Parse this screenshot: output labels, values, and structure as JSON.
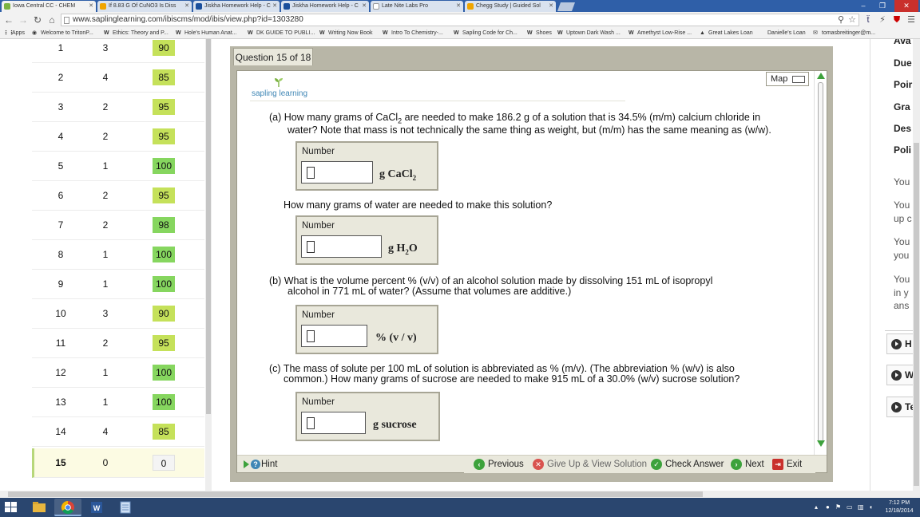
{
  "browser": {
    "tabs": [
      {
        "label": "Iowa Central CC - CHEM",
        "favicon_color": "#7cb342",
        "active": true
      },
      {
        "label": "If 8.83 G Of CuNO3 Is Diss",
        "favicon_color": "#f0a500",
        "active": false
      },
      {
        "label": "Jiskha Homework Help - C",
        "favicon_color": "#1a4f9c",
        "active": false
      },
      {
        "label": "Jiskha Homework Help - C",
        "favicon_color": "#1a4f9c",
        "active": false
      },
      {
        "label": "Late Nite Labs Pro",
        "favicon_color": "#cccccc",
        "active": false
      },
      {
        "label": "Chegg Study | Guided Sol",
        "favicon_color": "#f0a500",
        "active": false
      }
    ],
    "url": "www.saplinglearning.com/ibiscms/mod/ibis/view.php?id=1303280",
    "bookmarks": [
      {
        "label": "Apps",
        "icon": "apps-grid-icon"
      },
      {
        "label": "Welcome to TritonP...",
        "icon": "eye-icon"
      },
      {
        "label": "Ethics: Theory and P...",
        "icon": "wiley-icon"
      },
      {
        "label": "Hole's Human Anat...",
        "icon": "wiley-icon"
      },
      {
        "label": "DK GUIDE TO PUBLI...",
        "icon": "wiley-icon"
      },
      {
        "label": "Writing Now Book",
        "icon": "wiley-icon"
      },
      {
        "label": "Intro To Chemistry-...",
        "icon": "wiley-icon"
      },
      {
        "label": "Sapling Code for Ch...",
        "icon": "wiley-icon"
      },
      {
        "label": "Shoes",
        "icon": "wiley-icon"
      },
      {
        "label": "Uptown Dark Wash ...",
        "icon": "wiley-icon"
      },
      {
        "label": "Amethyst Low-Rise ...",
        "icon": "wiley-icon"
      },
      {
        "label": "Great Lakes Loan",
        "icon": "triangle-icon"
      },
      {
        "label": "Danielle's Loan",
        "icon": ""
      },
      {
        "label": "tomasbreitinger@m...",
        "icon": "mail-icon"
      }
    ]
  },
  "score_table": {
    "rows": [
      {
        "num": "1",
        "attempts": "3",
        "score": "90",
        "color": "lime"
      },
      {
        "num": "2",
        "attempts": "4",
        "score": "85",
        "color": "lime"
      },
      {
        "num": "3",
        "attempts": "2",
        "score": "95",
        "color": "lime"
      },
      {
        "num": "4",
        "attempts": "2",
        "score": "95",
        "color": "lime"
      },
      {
        "num": "5",
        "attempts": "1",
        "score": "100",
        "color": "green"
      },
      {
        "num": "6",
        "attempts": "2",
        "score": "95",
        "color": "lime"
      },
      {
        "num": "7",
        "attempts": "2",
        "score": "98",
        "color": "green"
      },
      {
        "num": "8",
        "attempts": "1",
        "score": "100",
        "color": "green"
      },
      {
        "num": "9",
        "attempts": "1",
        "score": "100",
        "color": "green"
      },
      {
        "num": "10",
        "attempts": "3",
        "score": "90",
        "color": "lime"
      },
      {
        "num": "11",
        "attempts": "2",
        "score": "95",
        "color": "lime"
      },
      {
        "num": "12",
        "attempts": "1",
        "score": "100",
        "color": "green"
      },
      {
        "num": "13",
        "attempts": "1",
        "score": "100",
        "color": "green"
      },
      {
        "num": "14",
        "attempts": "4",
        "score": "85",
        "color": "lime"
      },
      {
        "num": "15",
        "attempts": "0",
        "score": "0",
        "color": "none",
        "current": true
      }
    ]
  },
  "question": {
    "tab_label": "Question 15 of 18",
    "logo_text": "sapling learning",
    "map_label": "Map",
    "part_a_1": "(a) How many grams of CaCl",
    "part_a_sub": "2",
    "part_a_2": " are needed to make 186.2 g of a solution that is 34.5% (m/m) calcium chloride in",
    "part_a_line2": "water? Note that mass is not technically the same thing as weight, but (m/m) has the same meaning as (w/w).",
    "box1_label": "Number",
    "box1_unit_main": "g  CaCl",
    "box1_unit_sub": "2",
    "water_question": "How many grams of water are needed to make this solution?",
    "box2_label": "Number",
    "box2_unit_main": "g  H",
    "box2_unit_sub": "2",
    "box2_unit_end": "O",
    "part_b_line1": "(b) What is the volume percent % (v/v) of an alcohol solution made by dissolving 151 mL of isopropyl",
    "part_b_line2": "alcohol in 771 mL of water? (Assume that volumes are additive.)",
    "box3_label": "Number",
    "box3_unit": "%  (v / v)",
    "part_c_line1": "(c) The mass of solute per 100 mL of solution is abbreviated as % (m/v). (The abbreviation % (w/v) is also",
    "part_c_line2": "common.) How many grams of sucrose are needed to make 915 mL of a 30.0% (w/v) sucrose solution?",
    "box4_label": "Number",
    "box4_unit": "g  sucrose",
    "hint_label": "Hint",
    "actions": {
      "previous": "Previous",
      "give_up": "Give Up & View Solution",
      "check": "Check Answer",
      "next": "Next",
      "exit": "Exit"
    }
  },
  "right_sidebar": {
    "items": [
      "Ava",
      "Due",
      "Poir",
      "Gra",
      "Des",
      "Poli"
    ],
    "notes": [
      "You",
      "You",
      "up c",
      "You",
      "you",
      "You",
      "in y",
      "ans"
    ],
    "buttons": [
      "H",
      "W",
      "Te"
    ]
  },
  "taskbar": {
    "time": "7:12 PM",
    "date": "12/18/2014"
  }
}
